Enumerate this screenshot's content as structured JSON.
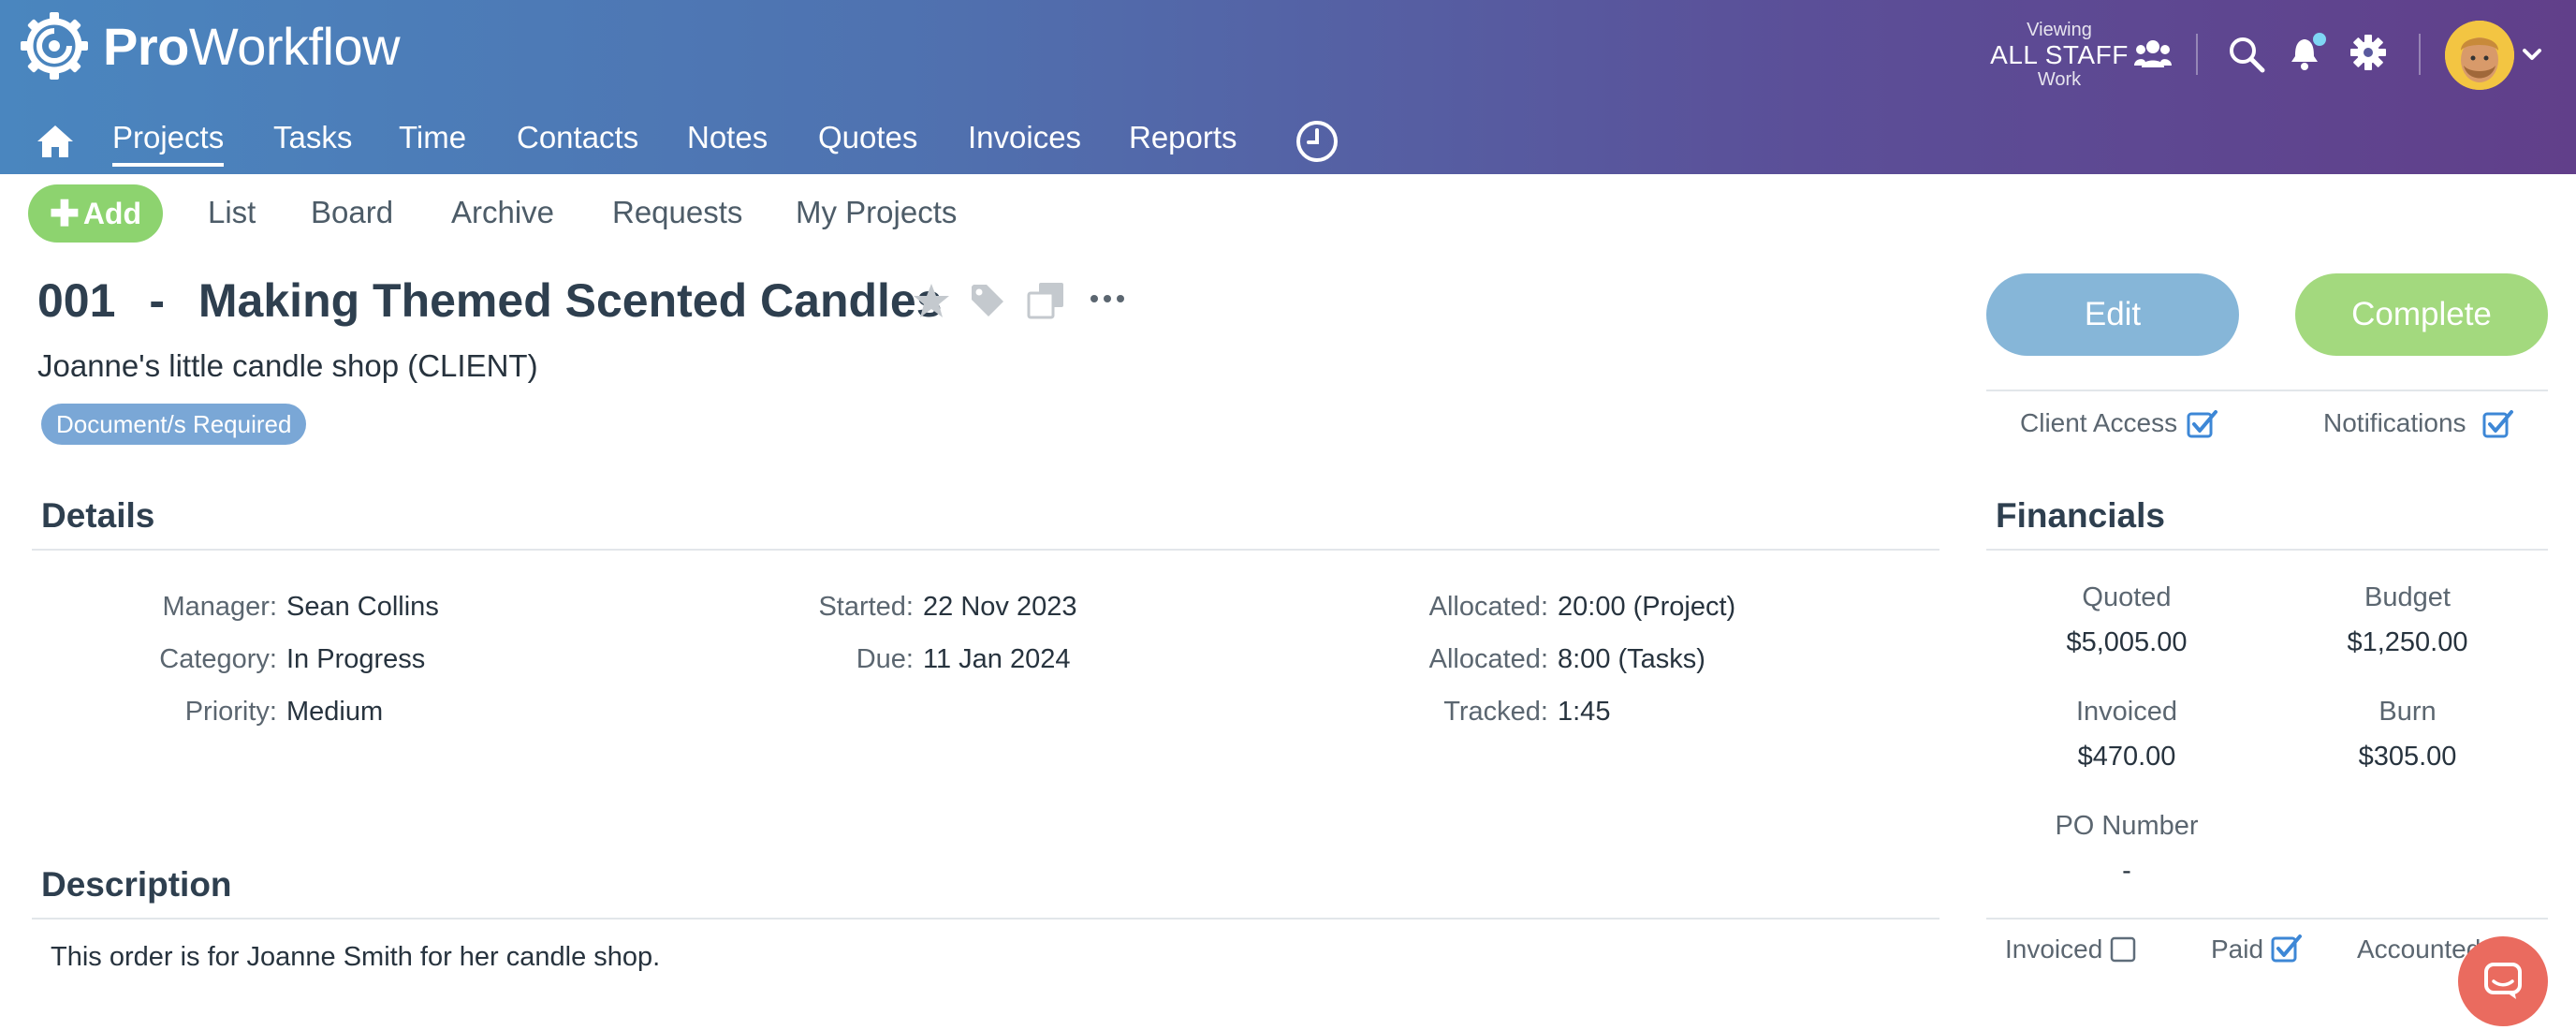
{
  "app": {
    "logo_bold": "Pro",
    "logo_light": "Workflow"
  },
  "viewing": {
    "label": "Viewing",
    "scope": "ALL STAFF",
    "sub": "Work"
  },
  "nav": {
    "items": [
      "Projects",
      "Tasks",
      "Time",
      "Contacts",
      "Notes",
      "Quotes",
      "Invoices",
      "Reports"
    ],
    "active": "Projects"
  },
  "subnav": {
    "add_label": "Add",
    "items": [
      "List",
      "Board",
      "Archive",
      "Requests",
      "My Projects"
    ]
  },
  "project": {
    "number": "001",
    "separator": "-",
    "name": "Making Themed Scented Candles",
    "client": "Joanne's little candle shop (CLIENT)",
    "badge": "Document/s Required"
  },
  "actions": {
    "edit": "Edit",
    "complete": "Complete"
  },
  "access": {
    "client_access": "Client Access",
    "client_access_checked": true,
    "notifications": "Notifications",
    "notifications_checked": true
  },
  "details": {
    "heading": "Details",
    "col1": [
      {
        "label": "Manager:",
        "value": "Sean Collins"
      },
      {
        "label": "Category:",
        "value": "In Progress"
      },
      {
        "label": "Priority:",
        "value": "Medium"
      }
    ],
    "col2": [
      {
        "label": "Started:",
        "value": "22 Nov 2023"
      },
      {
        "label": "Due:",
        "value": "11 Jan 2024"
      }
    ],
    "col3": [
      {
        "label": "Allocated:",
        "value": "20:00 (Project)"
      },
      {
        "label": "Allocated:",
        "value": "8:00 (Tasks)"
      },
      {
        "label": "Tracked:",
        "value": "1:45"
      }
    ]
  },
  "financials": {
    "heading": "Financials",
    "quoted_label": "Quoted",
    "quoted": "$5,005.00",
    "budget_label": "Budget",
    "budget": "$1,250.00",
    "invoiced_label": "Invoiced",
    "invoiced": "$470.00",
    "burn_label": "Burn",
    "burn": "$305.00",
    "po_label": "PO Number",
    "po": "-",
    "flags": {
      "invoiced": "Invoiced",
      "invoiced_checked": false,
      "paid": "Paid",
      "paid_checked": true,
      "accounted": "Accounted",
      "accounted_checked": false
    }
  },
  "description": {
    "heading": "Description",
    "line1": "This order is for Joanne Smith for her candle shop."
  },
  "colors": {
    "header_start": "#4a86bf",
    "header_end": "#613f8a",
    "accent_green": "#8dd36f",
    "edit_blue": "#86b6d8",
    "badge_blue": "#7aa7d6",
    "chat_red": "#ea6b5f"
  }
}
